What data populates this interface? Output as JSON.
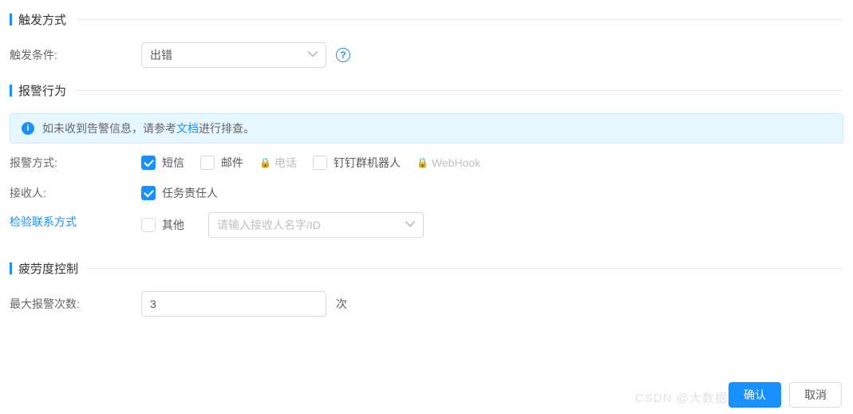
{
  "sections": {
    "trigger": {
      "title": "触发方式"
    },
    "alarm": {
      "title": "报警行为"
    },
    "fatigue": {
      "title": "疲劳度控制"
    }
  },
  "trigger": {
    "condition_label": "触发条件:",
    "condition_value": "出错"
  },
  "info_banner": {
    "prefix": "如未收到告警信息，请参考 ",
    "link": "文档",
    "suffix": " 进行排查。"
  },
  "alarm_method": {
    "label": "报警方式:",
    "options": {
      "sms": {
        "label": "短信",
        "checked": true,
        "locked": false
      },
      "email": {
        "label": "邮件",
        "checked": false,
        "locked": false
      },
      "phone": {
        "label": "电话",
        "checked": false,
        "locked": true
      },
      "dingtalk": {
        "label": "钉钉群机器人",
        "checked": false,
        "locked": false
      },
      "webhook": {
        "label": "WebHook",
        "checked": false,
        "locked": true
      }
    }
  },
  "recipient": {
    "label": "接收人:",
    "verify_link": "检验联系方式",
    "owner": {
      "label": "任务责任人",
      "checked": true
    },
    "other": {
      "label": "其他",
      "checked": false,
      "placeholder": "请输入接收人名字/ID"
    }
  },
  "fatigue": {
    "max_label": "最大报警次数:",
    "max_value": "3",
    "unit": "次"
  },
  "footer": {
    "confirm": "确认",
    "cancel": "取消"
  },
  "watermark": "CSDN @大数据 飞总"
}
